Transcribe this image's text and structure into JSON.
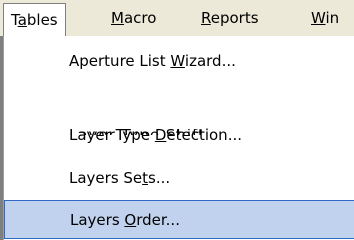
{
  "menubar": {
    "items": [
      {
        "pre": "T",
        "u": "a",
        "post": "bles"
      },
      {
        "pre": "",
        "u": "M",
        "post": "acro"
      },
      {
        "pre": "",
        "u": "R",
        "post": "eports"
      },
      {
        "pre": "",
        "u": "W",
        "post": "in"
      }
    ]
  },
  "dropdown": {
    "items": [
      {
        "pre": "Aperture List ",
        "u": "W",
        "post": "izard..."
      },
      {
        "pre": "Layer Type ",
        "u": "D",
        "post": "etection..."
      },
      {
        "pre": "Layers Se",
        "u": "t",
        "post": "s..."
      },
      {
        "pre": "Layers ",
        "u": "O",
        "post": "rder..."
      }
    ],
    "ghost_text": "Layer Type Shift..."
  },
  "colors": {
    "menubar_bg": "#ece9d8",
    "selection_bg": "#c1d2ee",
    "selection_border": "#316ac5"
  }
}
